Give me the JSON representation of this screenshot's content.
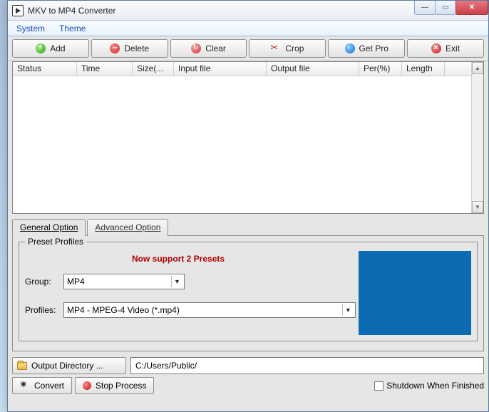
{
  "window": {
    "title": "MKV to MP4 Converter"
  },
  "menubar": {
    "system": "System",
    "theme": "Theme"
  },
  "toolbar": {
    "add": "Add",
    "delete": "Delete",
    "clear": "Clear",
    "crop": "Crop",
    "getpro": "Get Pro",
    "exit": "Exit"
  },
  "table": {
    "columns": {
      "status": "Status",
      "time": "Time",
      "size": "Size(...",
      "input": "Input file",
      "output": "Output file",
      "per": "Per(%)",
      "length": "Length"
    },
    "rows": []
  },
  "tabs": {
    "general": "General Option",
    "advanced": "Advanced Option"
  },
  "preset": {
    "legend": "Preset Profiles",
    "message": "Now support 2 Presets",
    "group_label": "Group:",
    "group_value": "MP4",
    "profiles_label": "Profiles:",
    "profiles_value": "MP4 - MPEG-4 Video (*.mp4)"
  },
  "output": {
    "button_label": "Output Directory ...",
    "path": "C:/Users/Public/"
  },
  "actions": {
    "convert": "Convert",
    "stop": "Stop Process",
    "shutdown": "Shutdown When Finished"
  }
}
